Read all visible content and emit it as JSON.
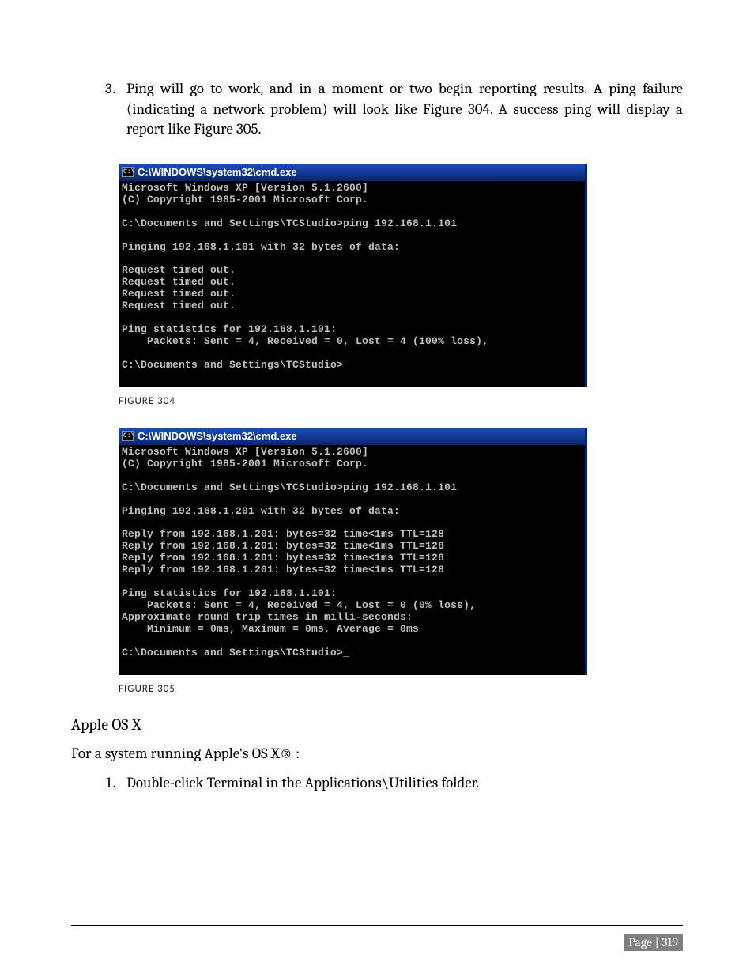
{
  "step3": {
    "number": 3,
    "text": "Ping will go to work, and in a moment or two begin reporting results.  A ping failure (indicating a network problem) will look like Figure 304.  A success ping will display a report like Figure 305."
  },
  "console1": {
    "title": "C:\\WINDOWS\\system32\\cmd.exe",
    "icon_label": "C:\\",
    "body": "Microsoft Windows XP [Version 5.1.2600]\n(C) Copyright 1985-2001 Microsoft Corp.\n\nC:\\Documents and Settings\\TCStudio>ping 192.168.1.101\n\nPinging 192.168.1.101 with 32 bytes of data:\n\nRequest timed out.\nRequest timed out.\nRequest timed out.\nRequest timed out.\n\nPing statistics for 192.168.1.101:\n    Packets: Sent = 4, Received = 0, Lost = 4 (100% loss),\n\nC:\\Documents and Settings\\TCStudio>"
  },
  "figure304": "FIGURE 304",
  "console2": {
    "title": "C:\\WINDOWS\\system32\\cmd.exe",
    "icon_label": "C:\\",
    "body": "Microsoft Windows XP [Version 5.1.2600]\n(C) Copyright 1985-2001 Microsoft Corp.\n\nC:\\Documents and Settings\\TCStudio>ping 192.168.1.101\n\nPinging 192.168.1.201 with 32 bytes of data:\n\nReply from 192.168.1.201: bytes=32 time<1ms TTL=128\nReply from 192.168.1.201: bytes=32 time<1ms TTL=128\nReply from 192.168.1.201: bytes=32 time<1ms TTL=128\nReply from 192.168.1.201: bytes=32 time<1ms TTL=128\n\nPing statistics for 192.168.1.101:\n    Packets: Sent = 4, Received = 4, Lost = 0 (0% loss),\nApproximate round trip times in milli-seconds:\n    Minimum = 0ms, Maximum = 0ms, Average = 0ms\n\nC:\\Documents and Settings\\TCStudio>_"
  },
  "figure305": "FIGURE 305",
  "apple_heading": "Apple OS X",
  "apple_intro": "For a system running Apple's OS X® :",
  "apple_step1": {
    "number": 1,
    "text": "Double-click Terminal in the Applications\\Utilities folder."
  },
  "page_number": "Page | 319"
}
